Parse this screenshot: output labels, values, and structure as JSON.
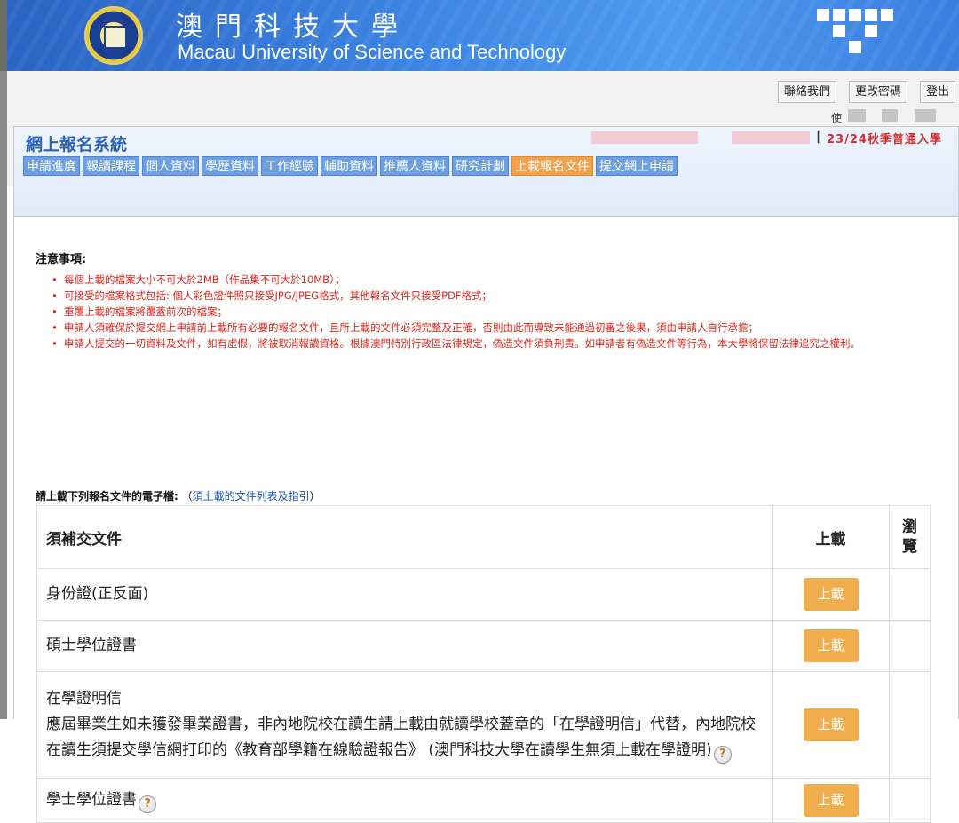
{
  "banner": {
    "title_zh": "澳門科技大學",
    "title_en": "Macau University of Science and Technology"
  },
  "top_actions": {
    "contact": "聯絡我們",
    "change_password": "更改密碼",
    "logout": "登出"
  },
  "user_label": "使",
  "header": {
    "system_title": "網上報名系統",
    "separator": "|",
    "term": "23/24秋季普通入學"
  },
  "tabs": [
    {
      "label": "申請進度",
      "active": false
    },
    {
      "label": "報讀課程",
      "active": false
    },
    {
      "label": "個人資料",
      "active": false
    },
    {
      "label": "學歷資料",
      "active": false
    },
    {
      "label": "工作經驗",
      "active": false
    },
    {
      "label": "輔助資料",
      "active": false
    },
    {
      "label": "推薦人資料",
      "active": false
    },
    {
      "label": "研究計劃",
      "active": false
    },
    {
      "label": "上載報名文件",
      "active": true
    },
    {
      "label": "提交網上申請",
      "active": false
    }
  ],
  "notice": {
    "title": "注意事項:",
    "items": [
      "每個上載的檔案大小不可大於2MB（作品集不可大於10MB）；",
      "可接受的檔案格式包括: 個人彩色證件照只接受JPG/JPEG格式，其他報名文件只接受PDF格式；",
      "重覆上載的檔案將覆蓋前次的檔案；",
      "申請人須確保於提交網上申請前上載所有必要的報名文件，且所上載的文件必須完整及正確，否則由此而導致未能通過初審之後果，須由申請人自行承擔；",
      "申請人提交的一切資料及文件，如有虛假，將被取消報讀資格。根據澳門特別行政區法律規定，偽造文件須負刑責。如申請者有偽造文件等行為，本大學將保留法律追究之權利。"
    ]
  },
  "upload_intro": {
    "prefix": "請上載下列報名文件的電子檔:",
    "open": "（",
    "link": "須上載的文件列表及指引",
    "close": "）"
  },
  "table": {
    "headers": {
      "document": "須補交文件",
      "upload": "上載",
      "browse": "瀏覽"
    },
    "rows": [
      {
        "name": "身份證(正反面)",
        "button": "上載"
      },
      {
        "name": "碩士學位證書",
        "button": "上載"
      },
      {
        "name": "在學證明信",
        "desc": "應屆畢業生如未獲發畢業證書，非內地院校在讀生請上載由就讀學校蓋章的「在學證明信」代替，內地院校在讀生須提交學信網打印的《教育部學籍在線驗證報告》 (澳門科技大學在讀學生無須上載在學證明)",
        "button": "上載"
      },
      {
        "name": "學士學位證書",
        "button": "上載"
      }
    ],
    "help_glyph": "?"
  },
  "colors": {
    "tab": "#6d9fe3",
    "tab_active": "#f3a24b",
    "upload_button": "#f0ad4e",
    "notice_text": "#e0271d",
    "system_title": "#2d63b4"
  }
}
